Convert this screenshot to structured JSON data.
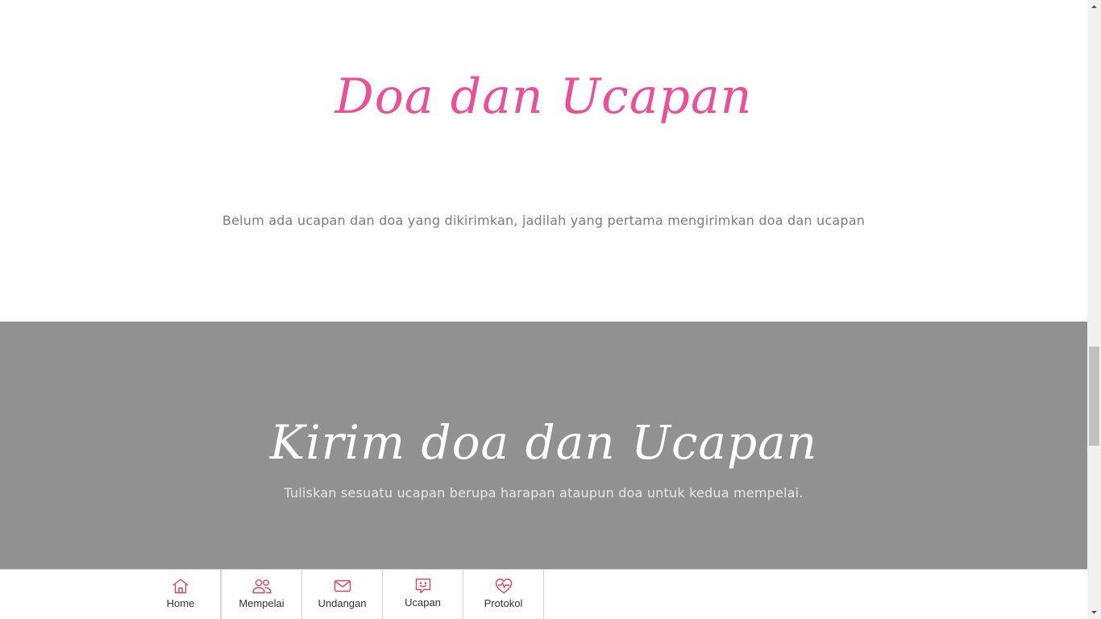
{
  "doa_section": {
    "title": "Doa dan Ucapan",
    "empty_message": "Belum ada ucapan dan doa yang dikirimkan, jadilah yang pertama mengirimkan doa dan ucapan"
  },
  "kirim_section": {
    "title": "Kirim doa dan Ucapan",
    "subtitle": "Tuliskan sesuatu ucapan berupa harapan ataupun doa untuk kedua mempelai."
  },
  "bottom_nav": {
    "items": [
      {
        "label": "Home",
        "icon": "home-icon"
      },
      {
        "label": "Mempelai",
        "icon": "users-icon"
      },
      {
        "label": "Undangan",
        "icon": "mail-icon"
      },
      {
        "label": "Ucapan",
        "icon": "chat-smile-icon"
      },
      {
        "label": "Protokol",
        "icon": "heart-pulse-icon"
      }
    ]
  },
  "colors": {
    "accent": "#ec4f97",
    "icon": "#d9465c",
    "section_gray": "#919191",
    "muted_text": "#7b7b7b"
  }
}
